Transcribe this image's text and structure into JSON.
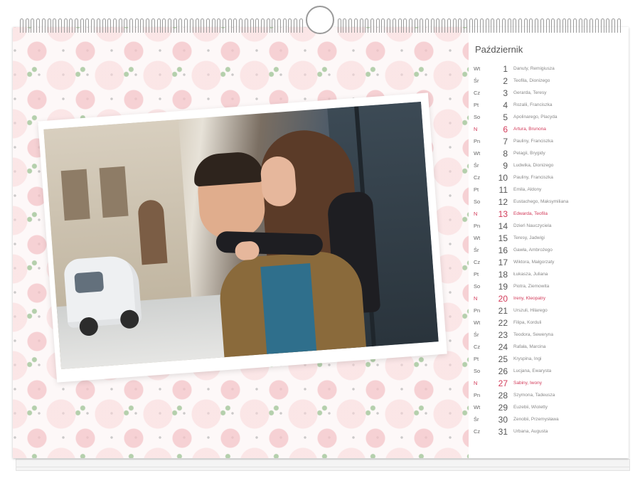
{
  "calendar": {
    "month": "Październik",
    "days": [
      {
        "weekday": "Wt",
        "day": "1",
        "names": "Danuty, Remigiusza",
        "sunday": false
      },
      {
        "weekday": "Śr",
        "day": "2",
        "names": "Teofila, Dionizego",
        "sunday": false
      },
      {
        "weekday": "Cz",
        "day": "3",
        "names": "Gerarda, Teresy",
        "sunday": false
      },
      {
        "weekday": "Pt",
        "day": "4",
        "names": "Rozalii, Franciszka",
        "sunday": false
      },
      {
        "weekday": "So",
        "day": "5",
        "names": "Apolinarego, Placyda",
        "sunday": false
      },
      {
        "weekday": "N",
        "day": "6",
        "names": "Artura, Brunona",
        "sunday": true
      },
      {
        "weekday": "Pn",
        "day": "7",
        "names": "Pauliny, Franciszka",
        "sunday": false
      },
      {
        "weekday": "Wt",
        "day": "8",
        "names": "Pelagii, Brygidy",
        "sunday": false
      },
      {
        "weekday": "Śr",
        "day": "9",
        "names": "Ludwika, Dionizego",
        "sunday": false
      },
      {
        "weekday": "Cz",
        "day": "10",
        "names": "Pauliny, Franciszka",
        "sunday": false
      },
      {
        "weekday": "Pt",
        "day": "11",
        "names": "Emila, Aldony",
        "sunday": false
      },
      {
        "weekday": "So",
        "day": "12",
        "names": "Eustachego, Maksymiliana",
        "sunday": false
      },
      {
        "weekday": "N",
        "day": "13",
        "names": "Edwarda, Teofila",
        "sunday": true
      },
      {
        "weekday": "Pn",
        "day": "14",
        "names": "Dzień Nauczyciela",
        "sunday": false
      },
      {
        "weekday": "Wt",
        "day": "15",
        "names": "Teresy, Jadwigi",
        "sunday": false
      },
      {
        "weekday": "Śr",
        "day": "16",
        "names": "Gawła, Ambrożego",
        "sunday": false
      },
      {
        "weekday": "Cz",
        "day": "17",
        "names": "Wiktora, Małgorzaty",
        "sunday": false
      },
      {
        "weekday": "Pt",
        "day": "18",
        "names": "Łukasza, Juliana",
        "sunday": false
      },
      {
        "weekday": "So",
        "day": "19",
        "names": "Piotra, Ziemowita",
        "sunday": false
      },
      {
        "weekday": "N",
        "day": "20",
        "names": "Ireny, Kleopatry",
        "sunday": true
      },
      {
        "weekday": "Pn",
        "day": "21",
        "names": "Urszuli, Hilarego",
        "sunday": false
      },
      {
        "weekday": "Wt",
        "day": "22",
        "names": "Filipa, Korduli",
        "sunday": false
      },
      {
        "weekday": "Śr",
        "day": "23",
        "names": "Teodora, Seweryna",
        "sunday": false
      },
      {
        "weekday": "Cz",
        "day": "24",
        "names": "Rafała, Marcina",
        "sunday": false
      },
      {
        "weekday": "Pt",
        "day": "25",
        "names": "Kryspina, Ingi",
        "sunday": false
      },
      {
        "weekday": "So",
        "day": "26",
        "names": "Lucjana, Ewarysta",
        "sunday": false
      },
      {
        "weekday": "N",
        "day": "27",
        "names": "Sabiny, Iwony",
        "sunday": true
      },
      {
        "weekday": "Pn",
        "day": "28",
        "names": "Szymona, Tadeusza",
        "sunday": false
      },
      {
        "weekday": "Wt",
        "day": "29",
        "names": "Euzebii, Wioletty",
        "sunday": false
      },
      {
        "weekday": "Śr",
        "day": "30",
        "names": "Zenobii, Przemysława",
        "sunday": false
      },
      {
        "weekday": "Cz",
        "day": "31",
        "names": "Urbana, Augusta",
        "sunday": false
      }
    ]
  },
  "colors": {
    "sunday": "#d23b5a",
    "text": "#666666",
    "petal": "#f4c4c8",
    "leaf": "#96be8c"
  },
  "icons": [
    "calendar-binding-icon",
    "hanger-hook-icon"
  ]
}
